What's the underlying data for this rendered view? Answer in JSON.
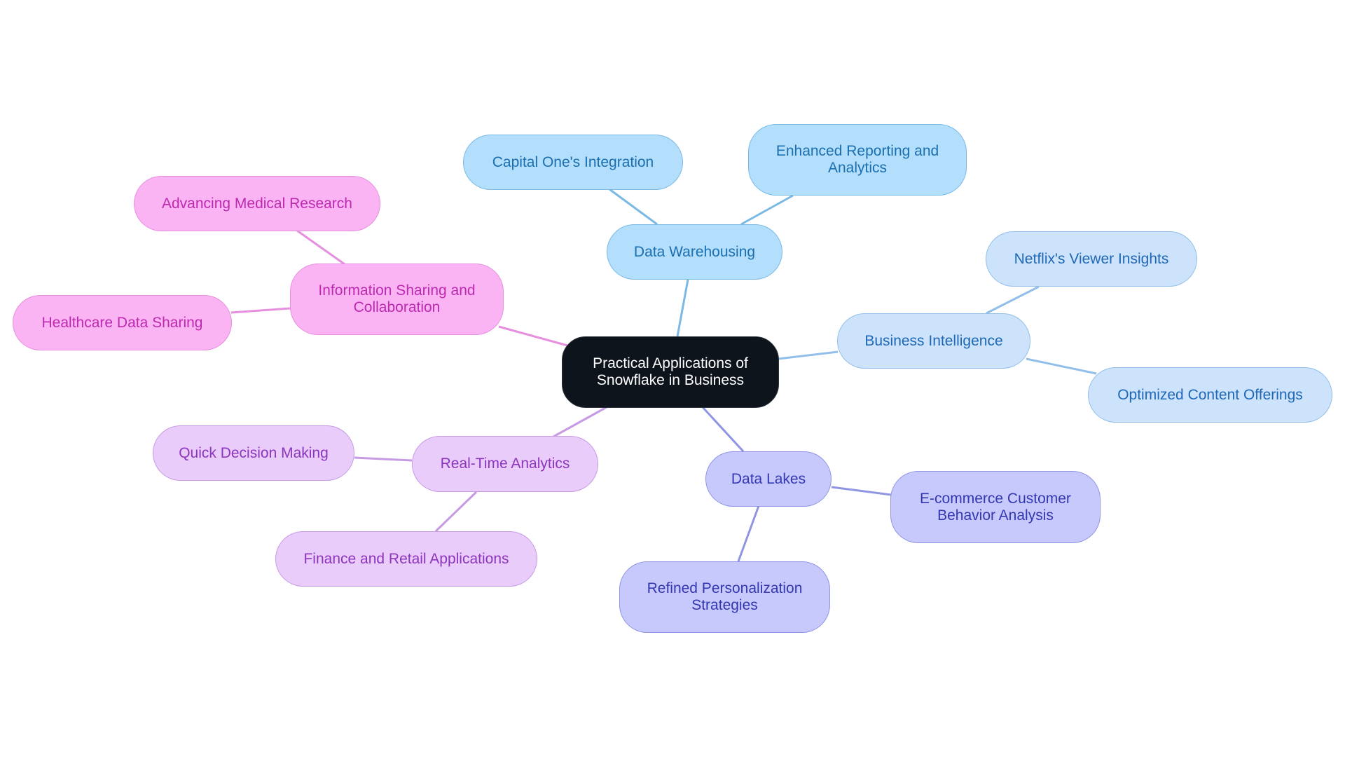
{
  "diagram": {
    "type": "mindmap",
    "root": {
      "id": "root",
      "label": "Practical Applications of\nSnowflake in Business"
    },
    "branches": [
      {
        "id": "dw",
        "label": "Data Warehousing",
        "color": "#7ab9e5",
        "children": [
          {
            "id": "dw1",
            "label": "Capital One's Integration"
          },
          {
            "id": "dw2",
            "label": "Enhanced Reporting and\nAnalytics"
          }
        ]
      },
      {
        "id": "bi",
        "label": "Business Intelligence",
        "color": "#92bfe9",
        "children": [
          {
            "id": "bi1",
            "label": "Netflix's Viewer Insights"
          },
          {
            "id": "bi2",
            "label": "Optimized Content Offerings"
          }
        ]
      },
      {
        "id": "dl",
        "label": "Data Lakes",
        "color": "#9095e3",
        "children": [
          {
            "id": "dl1",
            "label": "E-commerce Customer\nBehavior Analysis"
          },
          {
            "id": "dl2",
            "label": "Refined Personalization\nStrategies"
          }
        ]
      },
      {
        "id": "rt",
        "label": "Real-Time Analytics",
        "color": "#c79ae4",
        "children": [
          {
            "id": "rt1",
            "label": "Quick Decision Making"
          },
          {
            "id": "rt2",
            "label": "Finance and Retail Applications"
          }
        ]
      },
      {
        "id": "is",
        "label": "Information Sharing and\nCollaboration",
        "color": "#e68fde",
        "children": [
          {
            "id": "is1",
            "label": "Advancing Medical Research"
          },
          {
            "id": "is2",
            "label": "Healthcare Data Sharing"
          }
        ]
      }
    ]
  }
}
